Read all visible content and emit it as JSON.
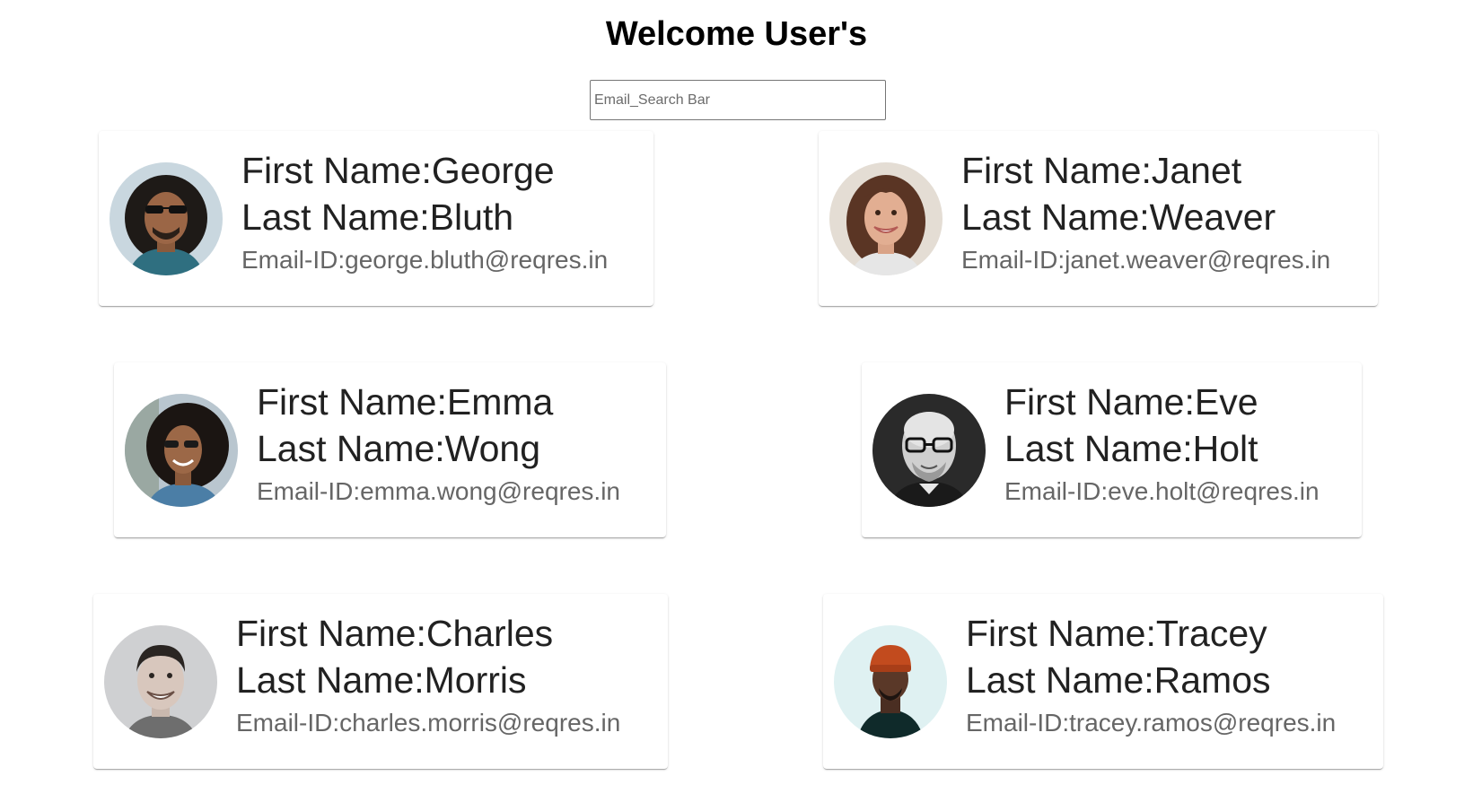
{
  "page": {
    "title": "Welcome User's"
  },
  "search": {
    "placeholder": "Email_Search Bar",
    "value": ""
  },
  "users": [
    {
      "first_name": "First Name:George",
      "last_name": "Last Name:Bluth",
      "email": "Email-ID:george.bluth@reqres.in",
      "avatar_icon": "person-avatar-icon"
    },
    {
      "first_name": "First Name:Janet",
      "last_name": "Last Name:Weaver",
      "email": "Email-ID:janet.weaver@reqres.in",
      "avatar_icon": "person-avatar-icon"
    },
    {
      "first_name": "First Name:Emma",
      "last_name": "Last Name:Wong",
      "email": "Email-ID:emma.wong@reqres.in",
      "avatar_icon": "person-avatar-icon"
    },
    {
      "first_name": "First Name:Eve",
      "last_name": "Last Name:Holt",
      "email": "Email-ID:eve.holt@reqres.in",
      "avatar_icon": "person-avatar-icon"
    },
    {
      "first_name": "First Name:Charles",
      "last_name": "Last Name:Morris",
      "email": "Email-ID:charles.morris@reqres.in",
      "avatar_icon": "person-avatar-icon"
    },
    {
      "first_name": "First Name:Tracey",
      "last_name": "Last Name:Ramos",
      "email": "Email-ID:tracey.ramos@reqres.in",
      "avatar_icon": "person-avatar-icon"
    }
  ]
}
